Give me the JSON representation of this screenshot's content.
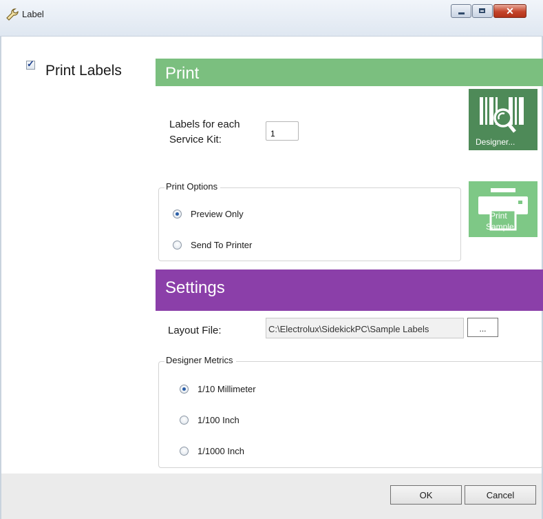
{
  "window": {
    "title": "Label",
    "icon": "wrench-icon"
  },
  "print_labels": {
    "label": "Print Labels",
    "checked": true
  },
  "print_section": {
    "banner": "Print",
    "labels_for_each_line1": "Labels for each",
    "labels_for_each_line2": "Service Kit:",
    "quantity": "1",
    "designer_tile": "Designer...",
    "sample_tile_line1": "Print",
    "sample_tile_line2": "Sample"
  },
  "print_options": {
    "title": "Print Options",
    "options": [
      {
        "label": "Preview Only",
        "selected": true
      },
      {
        "label": "Send To Printer",
        "selected": false
      }
    ]
  },
  "settings": {
    "banner": "Settings",
    "layout_file_label": "Layout File:",
    "layout_file_path": "C:\\Electrolux\\SidekickPC\\Sample Labels",
    "browse_label": "..."
  },
  "designer_metrics": {
    "title": "Designer Metrics",
    "options": [
      {
        "label": "1/10 Millimeter",
        "selected": true
      },
      {
        "label": "1/100 Inch",
        "selected": false
      },
      {
        "label": "1/1000 Inch",
        "selected": false
      }
    ]
  },
  "buttons": {
    "ok": "OK",
    "cancel": "Cancel"
  },
  "colors": {
    "print_banner": "#7bbf7f",
    "settings_banner": "#8b3fa9",
    "designer_tile": "#4e8a58",
    "sample_tile": "#7ec886"
  }
}
